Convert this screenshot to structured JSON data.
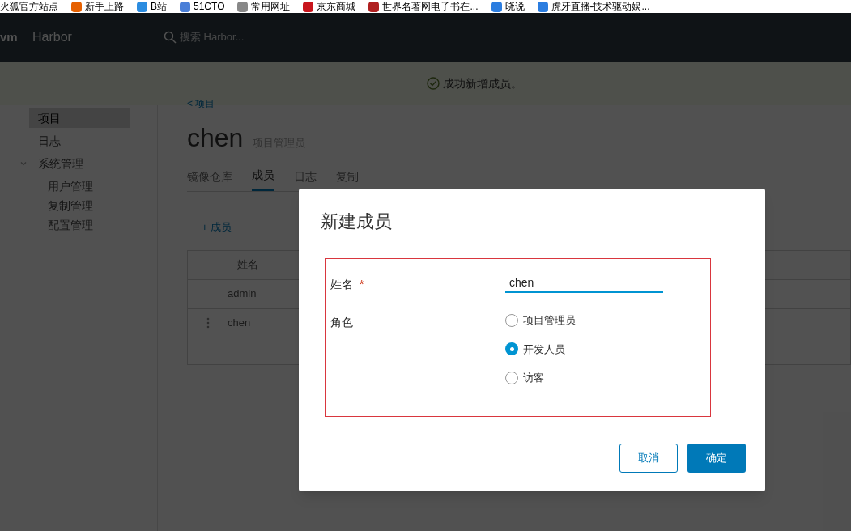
{
  "bookmarks": [
    {
      "label": "火狐官方站点"
    },
    {
      "label": "新手上路"
    },
    {
      "label": "B站"
    },
    {
      "label": "51CTO"
    },
    {
      "label": "常用网址"
    },
    {
      "label": "京东商城"
    },
    {
      "label": "世界名著网电子书在..."
    },
    {
      "label": "晓说"
    },
    {
      "label": "虎牙直播-技术驱动娱..."
    }
  ],
  "header": {
    "logo": "vm",
    "title": "Harbor",
    "search_placeholder": "搜索 Harbor..."
  },
  "banner": {
    "message": "成功新增成员。"
  },
  "sidebar": {
    "items": [
      {
        "label": "项目",
        "selected": true
      },
      {
        "label": "日志",
        "selected": false
      },
      {
        "label": "系统管理",
        "selected": false,
        "expanded": true,
        "children": [
          {
            "label": "用户管理",
            "selected": false
          },
          {
            "label": "复制管理",
            "selected": false
          },
          {
            "label": "配置管理",
            "selected": false
          }
        ]
      }
    ]
  },
  "project": {
    "breadcrumb": "< 项目",
    "name": "chen",
    "role": "项目管理员",
    "tabs": [
      {
        "label": "镜像仓库",
        "selected": false
      },
      {
        "label": "成员",
        "selected": true
      },
      {
        "label": "日志",
        "selected": false
      },
      {
        "label": "复制",
        "selected": false
      }
    ],
    "add_member": "+ 成员",
    "table": {
      "columns": [
        "姓名"
      ],
      "rows": [
        {
          "name": "admin",
          "menu": false
        },
        {
          "name": "chen",
          "menu": true
        }
      ]
    }
  },
  "dialog": {
    "title": "新建成员",
    "name_label": "姓名",
    "required_mark": "*",
    "name_value": "chen",
    "role_label": "角色",
    "roles": [
      {
        "label": "项目管理员",
        "selected": false
      },
      {
        "label": "开发人员",
        "selected": true
      },
      {
        "label": "访客",
        "selected": false
      }
    ],
    "buttons": [
      {
        "label": "取消",
        "kind": "secondary"
      },
      {
        "label": "确定",
        "kind": "primary"
      }
    ]
  }
}
